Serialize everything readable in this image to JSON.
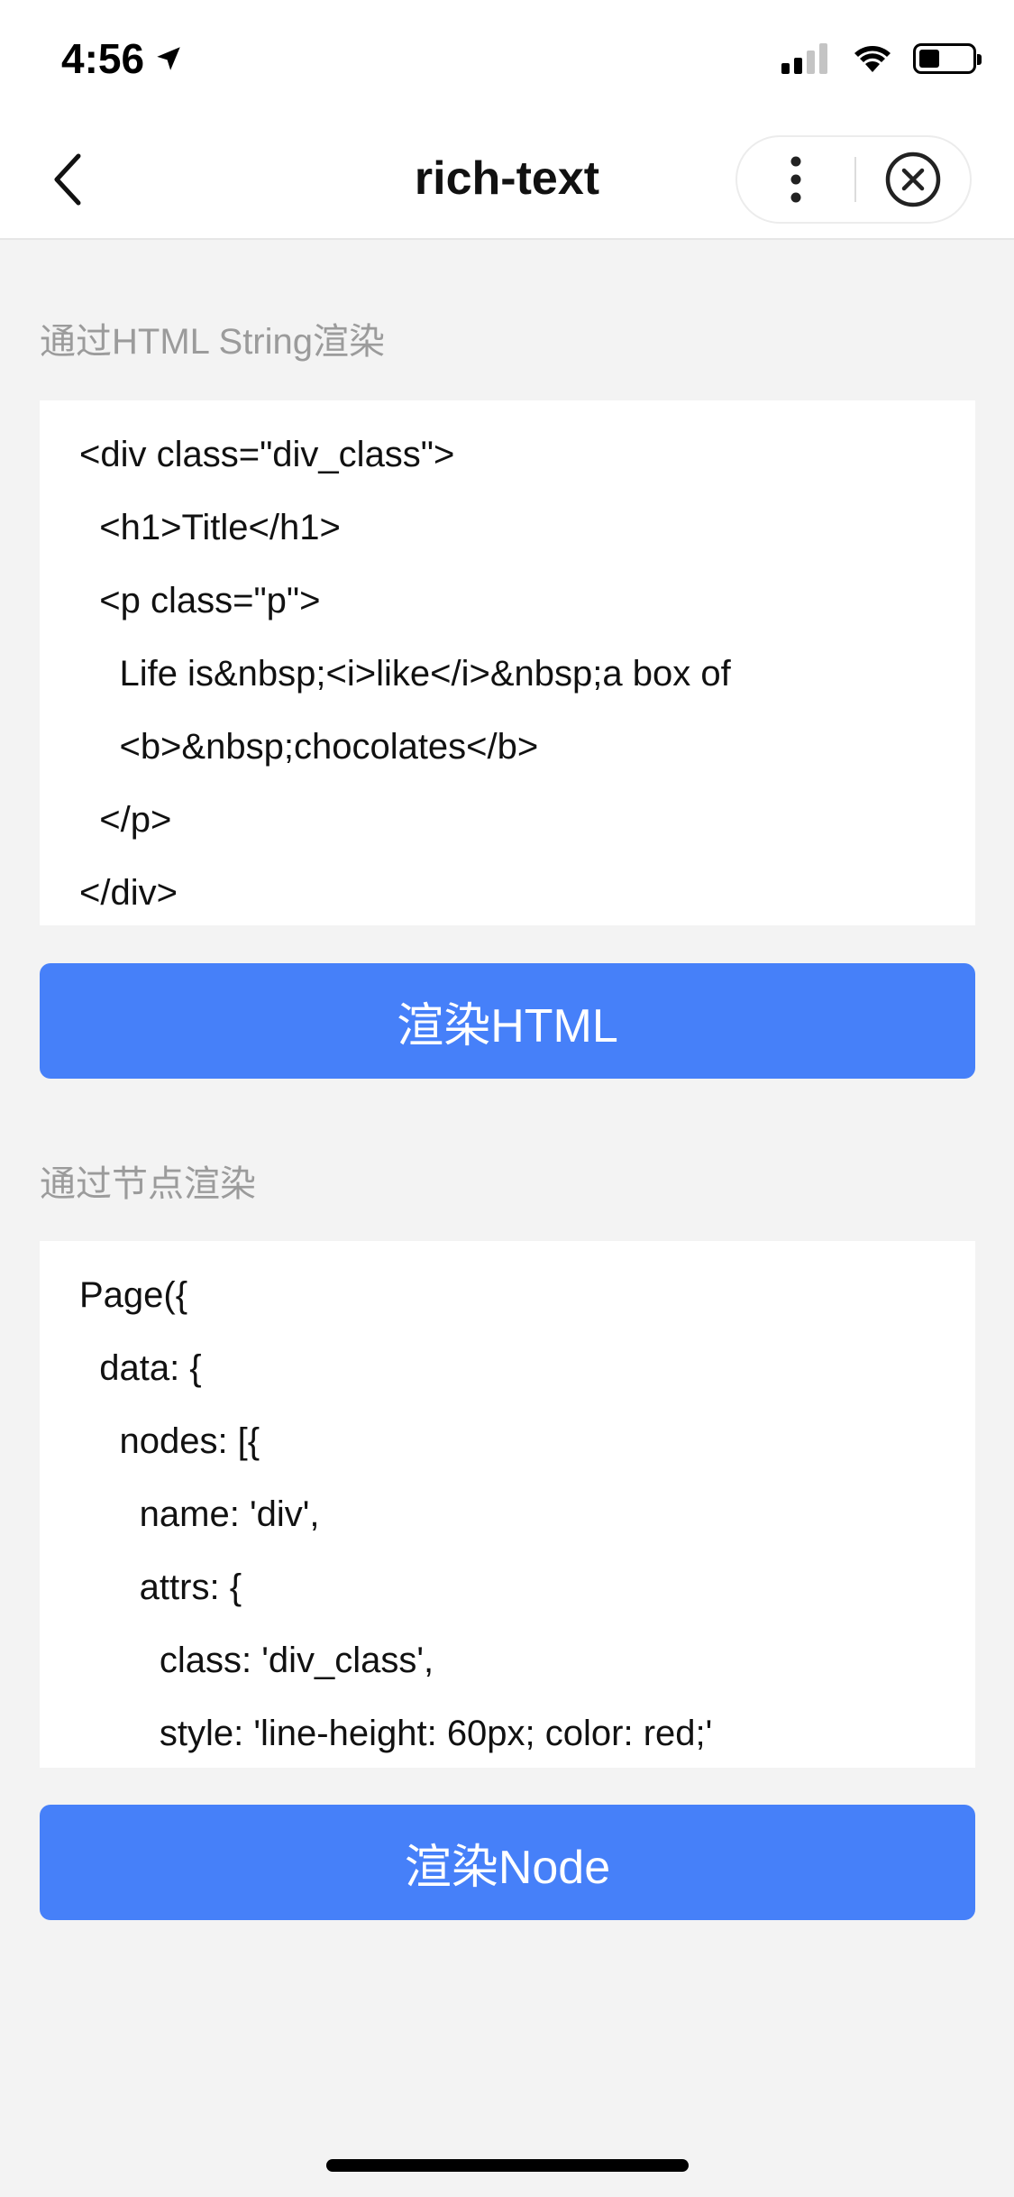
{
  "status_bar": {
    "time": "4:56"
  },
  "nav": {
    "title": "rich-text"
  },
  "html_section": {
    "label": "通过HTML String渲染",
    "code_lines": [
      "<div class=\"div_class\">",
      "  <h1>Title</h1>",
      "  <p class=\"p\">",
      "    Life is&nbsp;<i>like</i>&nbsp;a box of",
      "    <b>&nbsp;chocolates</b>",
      "  </p>",
      "</div>"
    ],
    "button_label": "渲染HTML"
  },
  "node_section": {
    "label": "通过节点渲染",
    "code_lines": [
      "Page({",
      "  data: {",
      "    nodes: [{",
      "      name: 'div',",
      "      attrs: {",
      "        class: 'div_class',",
      "        style: 'line-height: 60px; color: red;'"
    ],
    "button_label": "渲染Node"
  },
  "colors": {
    "accent": "#4680f9",
    "background": "#f3f3f3",
    "label": "#9b9b9b"
  }
}
